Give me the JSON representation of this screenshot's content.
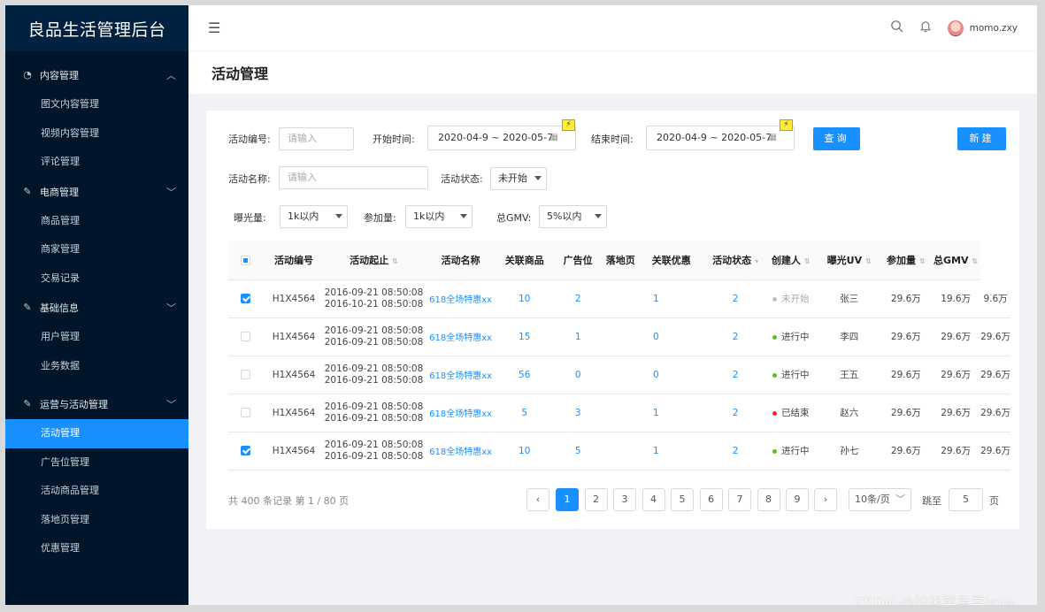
{
  "app": {
    "title": "良品生活管理后台"
  },
  "sidebar": {
    "groups": [
      {
        "label": "内容管理",
        "icon": "dashboard-icon",
        "items": [
          "图文内容管理",
          "视频内容管理",
          "评论管理"
        ]
      },
      {
        "label": "电商管理",
        "icon": "edit-icon",
        "items": [
          "商品管理",
          "商家管理",
          "交易记录"
        ]
      },
      {
        "label": "基础信息",
        "icon": "edit-icon",
        "items": [
          "用户管理",
          "业务数据"
        ]
      },
      {
        "label": "运营与活动管理",
        "icon": "edit-icon",
        "items": [
          "活动管理",
          "广告位管理",
          "活动商品管理",
          "落地页管理",
          "优惠管理"
        ]
      }
    ],
    "active": "活动管理"
  },
  "topbar": {
    "username": "momo.zxy"
  },
  "page": {
    "title": "活动管理"
  },
  "filters": {
    "id_label": "活动编号:",
    "id_placeholder": "请输入",
    "start_label": "开始时间:",
    "start_value": "2020-04-9 ~ 2020-05-7",
    "end_label": "结束时间:",
    "end_value": "2020-04-9 ~ 2020-05-7",
    "query_button": "查询",
    "new_button": "新建",
    "name_label": "活动名称:",
    "name_placeholder": "请输入",
    "status_label": "活动状态:",
    "status_value": "未开始",
    "exposure_label": "曝光量:",
    "exposure_value": "1k以内",
    "participation_label": "参加量:",
    "participation_value": "1k以内",
    "gmv_label": "总GMV:",
    "gmv_value": "5%以内"
  },
  "table": {
    "headers": [
      "活动编号",
      "活动起止",
      "活动名称",
      "关联商品",
      "广告位",
      "落地页",
      "关联优惠",
      "活动状态",
      "创建人",
      "曝光UV",
      "参加量",
      "总GMV"
    ],
    "rows": [
      {
        "checked": true,
        "id": "H1X4564",
        "start": "2016-09-21  08:50:08",
        "end": "2016-10-21  08:50:08",
        "name": "618全场特惠xx",
        "goods": "10",
        "ads": "2",
        "landing": "1",
        "coupons": "2",
        "status": "未开始",
        "status_color": "#bfbfbf",
        "creator": "张三",
        "uv": "29.6万",
        "join": "19.6万",
        "gmv": "9.6万"
      },
      {
        "checked": false,
        "id": "H1X4564",
        "start": "2016-09-21  08:50:08",
        "end": "2016-09-21  08:50:08",
        "name": "618全场特惠xx",
        "goods": "15",
        "ads": "1",
        "landing": "0",
        "coupons": "2",
        "status": "进行中",
        "status_color": "#52c41a",
        "creator": "李四",
        "uv": "29.6万",
        "join": "29.6万",
        "gmv": "29.6万"
      },
      {
        "checked": false,
        "id": "H1X4564",
        "start": "2016-09-21  08:50:08",
        "end": "2016-09-21  08:50:08",
        "name": "618全场特惠xx",
        "goods": "56",
        "ads": "0",
        "landing": "0",
        "coupons": "2",
        "status": "进行中",
        "status_color": "#52c41a",
        "creator": "王五",
        "uv": "29.6万",
        "join": "29.6万",
        "gmv": "29.6万"
      },
      {
        "checked": false,
        "id": "H1X4564",
        "start": "2016-09-21  08:50:08",
        "end": "2016-09-21  08:50:08",
        "name": "618全场特惠xx",
        "goods": "5",
        "ads": "3",
        "landing": "1",
        "coupons": "2",
        "status": "已结束",
        "status_color": "#f5222d",
        "creator": "赵六",
        "uv": "29.6万",
        "join": "29.6万",
        "gmv": "29.6万"
      },
      {
        "checked": true,
        "id": "H1X4564",
        "start": "2016-09-21  08:50:08",
        "end": "2016-09-21  08:50:08",
        "name": "618全场特惠xx",
        "goods": "10",
        "ads": "5",
        "landing": "1",
        "coupons": "2",
        "status": "进行中",
        "status_color": "#52c41a",
        "creator": "孙七",
        "uv": "29.6万",
        "join": "29.6万",
        "gmv": "29.6万"
      }
    ]
  },
  "pagination": {
    "summary": "共 400 条记录 第 1 / 80 页",
    "pages": [
      "1",
      "2",
      "3",
      "4",
      "5",
      "6",
      "7",
      "8",
      "9"
    ],
    "current": "1",
    "page_size": "10条/页",
    "jump_label": "跳至",
    "jump_value": "5",
    "jump_suffix": "页"
  },
  "watermark": "CSDN @垃圾菜鸟学java",
  "colors": {
    "primary": "#1890ff",
    "sidebar": "#001529",
    "logo_bg": "#002140"
  }
}
